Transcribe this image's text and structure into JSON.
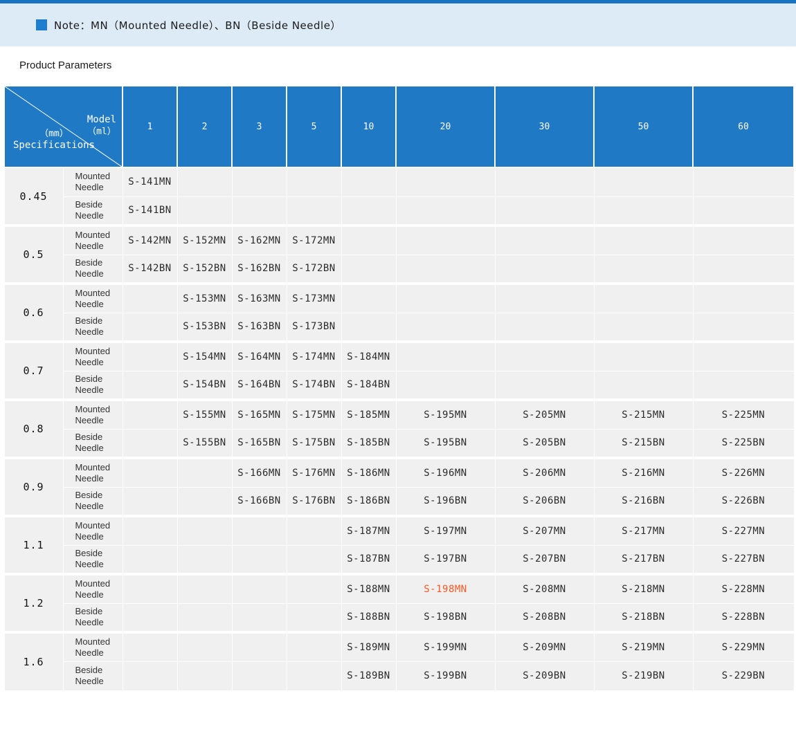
{
  "colors": {
    "topbar": "#1a73c2",
    "note_band_bg": "#dcebf6",
    "note_bullet": "#1e7fd0",
    "header_bg": "#2079c4",
    "cell_bg": "#f0f0f0",
    "highlight": "#ff5722"
  },
  "note": {
    "bullet_icon": "square-bullet-icon",
    "text": "Note：MN（Mounted Needle）、BN（Beside Needle）"
  },
  "section_title": "Product Parameters",
  "table": {
    "corner": {
      "top_label": "Model",
      "top_unit": "（ml）",
      "bottom_unit": "（mm）",
      "bottom_label": "Specifications"
    },
    "columns": [
      "1",
      "2",
      "3",
      "5",
      "10",
      "20",
      "30",
      "50",
      "60"
    ],
    "row_labels": {
      "mounted": "Mounted Needle",
      "beside": "Beside Needle"
    },
    "highlight": {
      "code": "S-198MN",
      "color": "#ff5722"
    },
    "groups": [
      {
        "spec": "0.45",
        "mounted": [
          "S-141MN",
          "",
          "",
          "",
          "",
          "",
          "",
          "",
          ""
        ],
        "beside": [
          "S-141BN",
          "",
          "",
          "",
          "",
          "",
          "",
          "",
          ""
        ]
      },
      {
        "spec": "0.5",
        "mounted": [
          "S-142MN",
          "S-152MN",
          "S-162MN",
          "S-172MN",
          "",
          "",
          "",
          "",
          ""
        ],
        "beside": [
          "S-142BN",
          "S-152BN",
          "S-162BN",
          "S-172BN",
          "",
          "",
          "",
          "",
          ""
        ]
      },
      {
        "spec": "0.6",
        "mounted": [
          "",
          "S-153MN",
          "S-163MN",
          "S-173MN",
          "",
          "",
          "",
          "",
          ""
        ],
        "beside": [
          "",
          "S-153BN",
          "S-163BN",
          "S-173BN",
          "",
          "",
          "",
          "",
          ""
        ]
      },
      {
        "spec": "0.7",
        "mounted": [
          "",
          "S-154MN",
          "S-164MN",
          "S-174MN",
          "S-184MN",
          "",
          "",
          "",
          ""
        ],
        "beside": [
          "",
          "S-154BN",
          "S-164BN",
          "S-174BN",
          "S-184BN",
          "",
          "",
          "",
          ""
        ]
      },
      {
        "spec": "0.8",
        "mounted": [
          "",
          "S-155MN",
          "S-165MN",
          "S-175MN",
          "S-185MN",
          "S-195MN",
          "S-205MN",
          "S-215MN",
          "S-225MN"
        ],
        "beside": [
          "",
          "S-155BN",
          "S-165BN",
          "S-175BN",
          "S-185BN",
          "S-195BN",
          "S-205BN",
          "S-215BN",
          "S-225BN"
        ]
      },
      {
        "spec": "0.9",
        "mounted": [
          "",
          "",
          "S-166MN",
          "S-176MN",
          "S-186MN",
          "S-196MN",
          "S-206MN",
          "S-216MN",
          "S-226MN"
        ],
        "beside": [
          "",
          "",
          "S-166BN",
          "S-176BN",
          "S-186BN",
          "S-196BN",
          "S-206BN",
          "S-216BN",
          "S-226BN"
        ]
      },
      {
        "spec": "1.1",
        "mounted": [
          "",
          "",
          "",
          "",
          "S-187MN",
          "S-197MN",
          "S-207MN",
          "S-217MN",
          "S-227MN"
        ],
        "beside": [
          "",
          "",
          "",
          "",
          "S-187BN",
          "S-197BN",
          "S-207BN",
          "S-217BN",
          "S-227BN"
        ]
      },
      {
        "spec": "1.2",
        "mounted": [
          "",
          "",
          "",
          "",
          "S-188MN",
          "S-198MN",
          "S-208MN",
          "S-218MN",
          "S-228MN"
        ],
        "beside": [
          "",
          "",
          "",
          "",
          "S-188BN",
          "S-198BN",
          "S-208BN",
          "S-218BN",
          "S-228BN"
        ]
      },
      {
        "spec": "1.6",
        "mounted": [
          "",
          "",
          "",
          "",
          "S-189MN",
          "S-199MN",
          "S-209MN",
          "S-219MN",
          "S-229MN"
        ],
        "beside": [
          "",
          "",
          "",
          "",
          "S-189BN",
          "S-199BN",
          "S-209BN",
          "S-219BN",
          "S-229BN"
        ]
      }
    ]
  }
}
